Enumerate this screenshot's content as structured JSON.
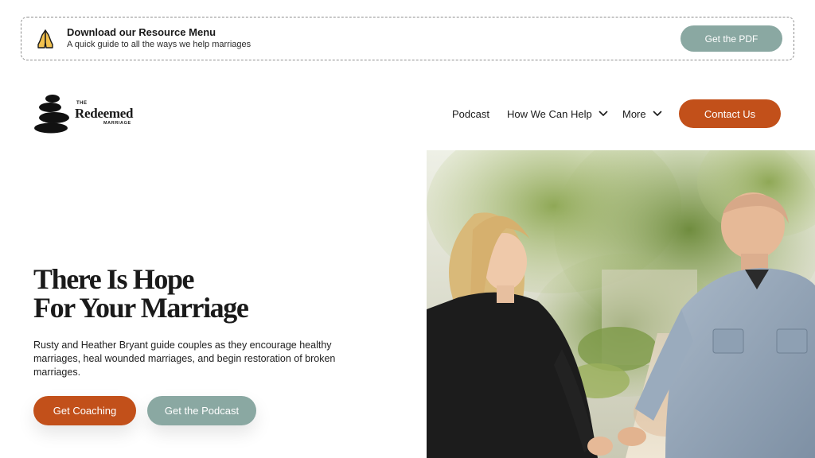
{
  "banner": {
    "icon": "praying-hands-icon",
    "title": "Download our Resource Menu",
    "subtitle": "A quick guide to all the ways we help marriages",
    "button_label": "Get the PDF"
  },
  "logo": {
    "the": "THE",
    "name": "Redeemed",
    "marriage": "MARRIAGE"
  },
  "nav": {
    "items": [
      {
        "label": "Podcast"
      },
      {
        "label": "How We Can Help"
      },
      {
        "label": "More"
      }
    ],
    "contact_label": "Contact Us"
  },
  "hero": {
    "title_line1": "There Is Hope",
    "title_line2": "For Your Marriage",
    "description": "Rusty and Heather Bryant guide couples as they encourage healthy marriages, heal wounded marriages, and begin restoration of broken marriages.",
    "primary_button": "Get Coaching",
    "secondary_button": "Get the Podcast"
  },
  "colors": {
    "accent_orange": "#c2501a",
    "accent_sage": "#8aa8a2",
    "text_dark": "#1a1a1a"
  }
}
